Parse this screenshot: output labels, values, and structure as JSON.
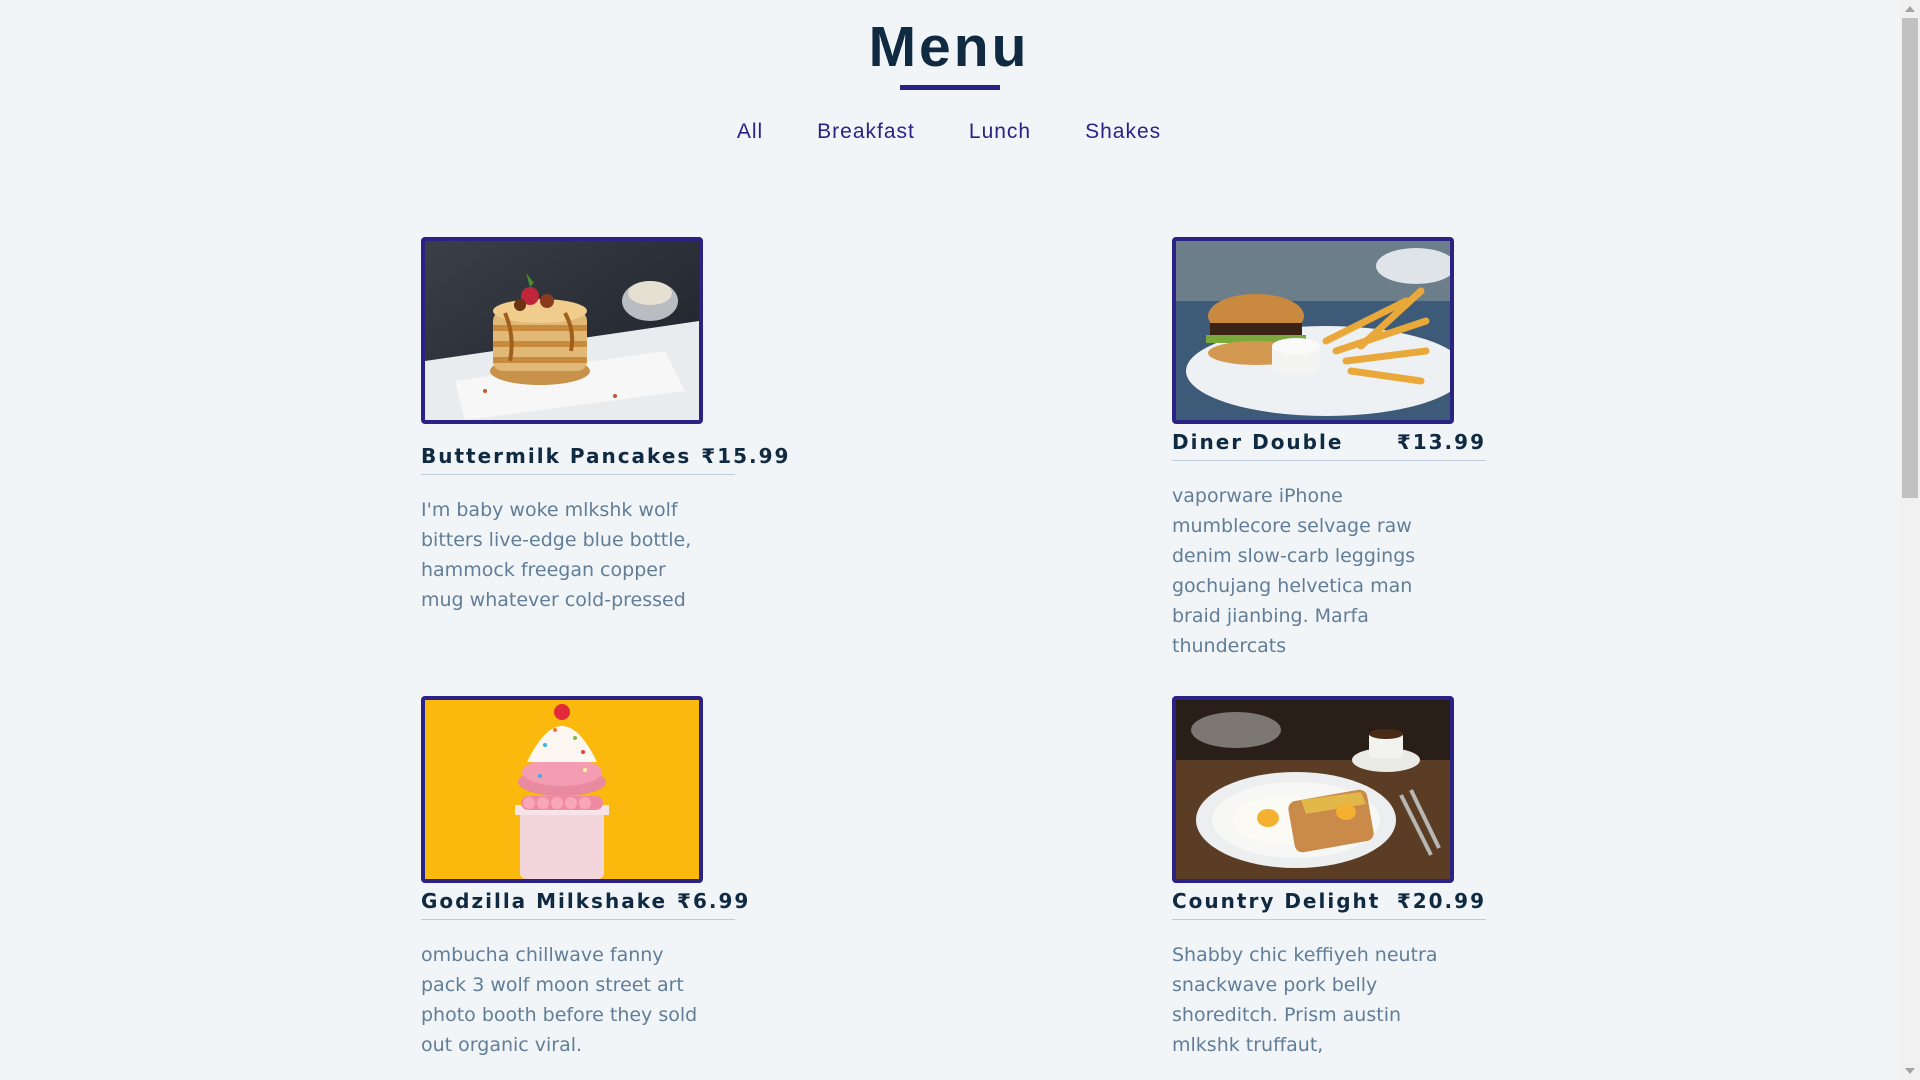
{
  "page": {
    "title": "Menu"
  },
  "filters": [
    {
      "label": "All"
    },
    {
      "label": "Breakfast"
    },
    {
      "label": "Lunch"
    },
    {
      "label": "Shakes"
    }
  ],
  "items": [
    {
      "name": "Buttermilk Pancakes",
      "price": "₹15.99",
      "description": "I'm baby woke mlkshk wolf bitters live-edge blue bottle, hammock freegan copper mug whatever cold-pressed",
      "image": "pancakes-photo"
    },
    {
      "name": "Diner Double",
      "price": "₹13.99",
      "description": "vaporware iPhone mumblecore selvage raw denim slow-carb leggings gochujang helvetica man braid jianbing. Marfa thundercats",
      "image": "burger-fries-photo"
    },
    {
      "name": "Godzilla Milkshake",
      "price": "₹6.99",
      "description": "ombucha chillwave fanny pack 3 wolf moon street art photo booth before they sold out organic viral.",
      "image": "milkshake-photo"
    },
    {
      "name": "Country Delight",
      "price": "₹20.99",
      "description": "Shabby chic keffiyeh neutra snackwave pork belly shoreditch. Prism austin mlkshk truffaut,",
      "image": "eggs-toast-photo"
    }
  ],
  "colors": {
    "background": "#f1f5f8",
    "accent": "#2a2385",
    "heading": "#102a42",
    "body_text": "#617d98"
  }
}
